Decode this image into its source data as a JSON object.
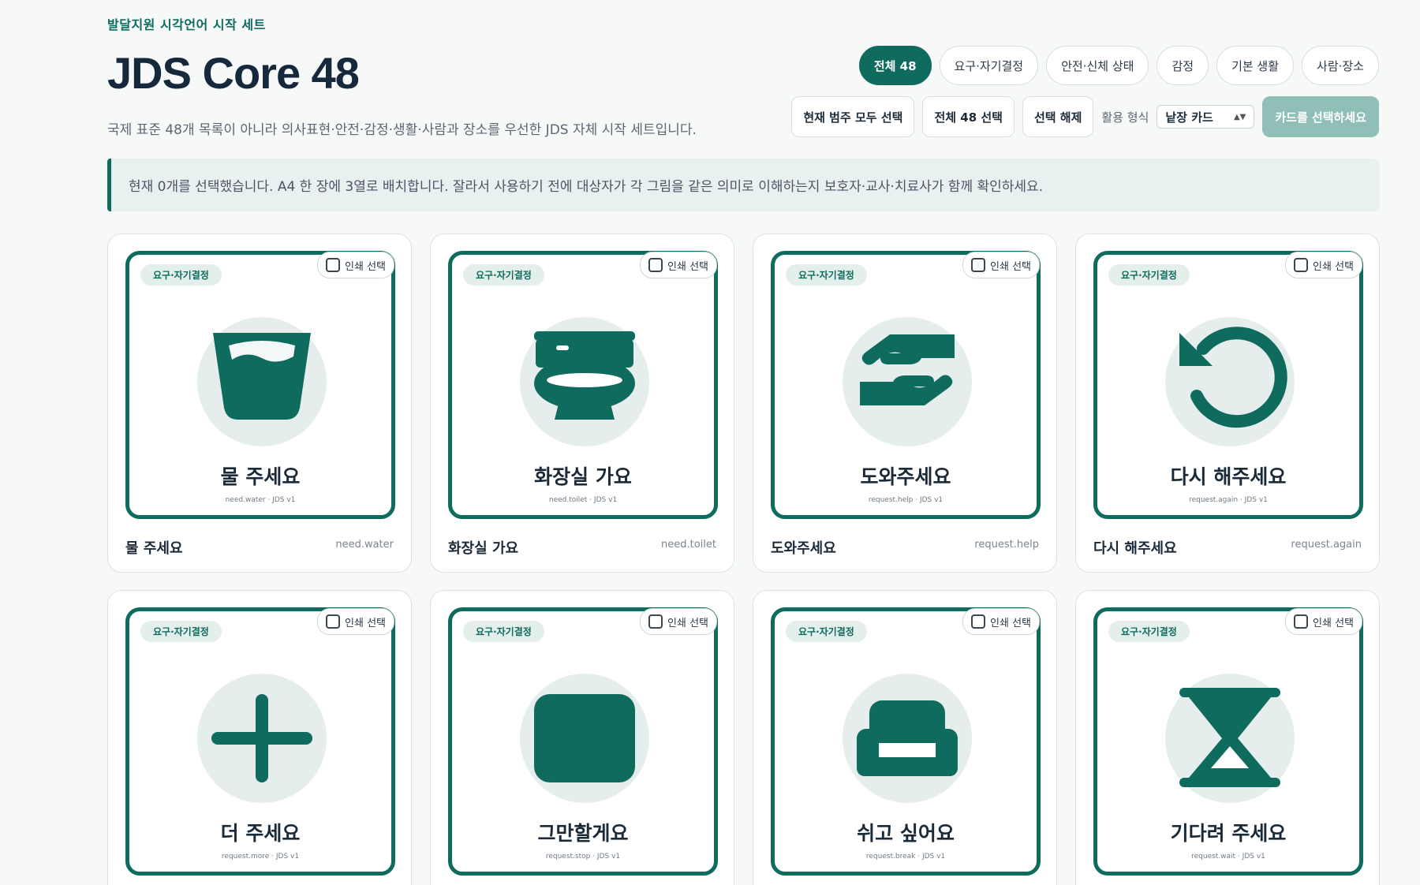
{
  "header": {
    "eyebrow": "발달지원 시각언어 시작 세트",
    "title": "JDS Core 48",
    "subtitle": "국제 표준 48개 목록이 아니라 의사표현·안전·감정·생활·사람과 장소를 우선한 JDS 자체 시작 세트입니다."
  },
  "filters": [
    {
      "label": "전체 48",
      "active": true
    },
    {
      "label": "요구·자기결정",
      "active": false
    },
    {
      "label": "안전·신체 상태",
      "active": false
    },
    {
      "label": "감정",
      "active": false
    },
    {
      "label": "기본 생활",
      "active": false
    },
    {
      "label": "사람·장소",
      "active": false
    }
  ],
  "actions": {
    "select_category": "현재 범주 모두 선택",
    "select_all": "전체 48 선택",
    "clear": "선택 해제",
    "format_label": "활용 형식",
    "format_value": "낱장 카드",
    "primary": "카드를 선택하세요"
  },
  "notice": "현재 0개를 선택했습니다. A4 한 장에 3열로 배치합니다. 잘라서 사용하기 전에 대상자가 각 그림을 같은 의미로 이해하는지 보호자·교사·치료사가 함께 확인하세요.",
  "colors": {
    "accent": "#0f6b5e",
    "accent_soft": "#e5eeec",
    "primary_disabled": "#8fbfb6"
  },
  "cards": [
    {
      "category": "요구·자기결정",
      "select_label": "인쇄 선택",
      "icon": "cup-icon",
      "label": "물 주세요",
      "code_line": "need.water · JDS v1",
      "name": "물 주세요",
      "code": "need.water"
    },
    {
      "category": "요구·자기결정",
      "select_label": "인쇄 선택",
      "icon": "toilet-icon",
      "label": "화장실 가요",
      "code_line": "need.toilet · JDS v1",
      "name": "화장실 가요",
      "code": "need.toilet"
    },
    {
      "category": "요구·자기결정",
      "select_label": "인쇄 선택",
      "icon": "helping-hands-icon",
      "label": "도와주세요",
      "code_line": "request.help · JDS v1",
      "name": "도와주세요",
      "code": "request.help"
    },
    {
      "category": "요구·자기결정",
      "select_label": "인쇄 선택",
      "icon": "redo-arrow-icon",
      "label": "다시 해주세요",
      "code_line": "request.again · JDS v1",
      "name": "다시 해주세요",
      "code": "request.again"
    },
    {
      "category": "요구·자기결정",
      "select_label": "인쇄 선택",
      "icon": "plus-icon",
      "label": "더 주세요",
      "code_line": "request.more · JDS v1",
      "name": "",
      "code": ""
    },
    {
      "category": "요구·자기결정",
      "select_label": "인쇄 선택",
      "icon": "stop-square-icon",
      "label": "그만할게요",
      "code_line": "request.stop · JDS v1",
      "name": "",
      "code": ""
    },
    {
      "category": "요구·자기결정",
      "select_label": "인쇄 선택",
      "icon": "sofa-icon",
      "label": "쉬고 싶어요",
      "code_line": "request.break · JDS v1",
      "name": "",
      "code": ""
    },
    {
      "category": "요구·자기결정",
      "select_label": "인쇄 선택",
      "icon": "hourglass-icon",
      "label": "기다려 주세요",
      "code_line": "request.wait · JDS v1",
      "name": "",
      "code": ""
    }
  ]
}
